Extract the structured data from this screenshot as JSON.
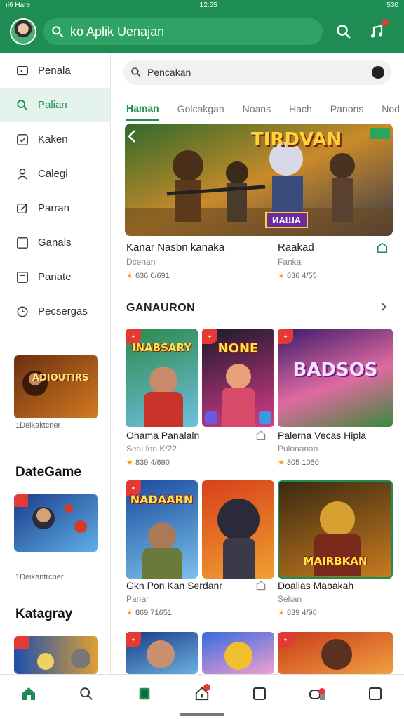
{
  "status": {
    "left": "ıl6 Hare",
    "center": "12:55",
    "right": "530"
  },
  "topbar": {
    "search_text": "ko Aplik Uenajan"
  },
  "sidebar": {
    "items": [
      {
        "label": "Penala",
        "icon": "tv-icon"
      },
      {
        "label": "Palian",
        "icon": "search-icon"
      },
      {
        "label": "Kaken",
        "icon": "checkbox-icon"
      },
      {
        "label": "Calegi",
        "icon": "person-icon"
      },
      {
        "label": "Parran",
        "icon": "edit-icon"
      },
      {
        "label": "Ganals",
        "icon": "square-icon"
      },
      {
        "label": "Panate",
        "icon": "bookmark-icon"
      },
      {
        "label": "Pecsergas",
        "icon": "clock-icon"
      }
    ],
    "card1_caption": "1Deikaktcner",
    "heading1": "DateGame",
    "card2_caption": "1Deikantrcner",
    "heading2": "Katagray"
  },
  "search": {
    "placeholder": "Pencakan"
  },
  "tabs": [
    "Haman",
    "Golcakgan",
    "Noans",
    "Hach",
    "Panons",
    "Nod"
  ],
  "banner": {
    "title_art": "TIRDVAN",
    "sub_art": "ИАША",
    "name_left": "Kanar Nasbn kanaka",
    "sub_left": "Dcenan",
    "rating_left": "636 0/691",
    "name_right": "Raakad",
    "sub_right": "Fanka",
    "rating_right": "836 4/55"
  },
  "section": {
    "title": "GANAURON"
  },
  "grid": [
    {
      "art": "INABSARY",
      "name": "Ohama Panalaln",
      "sub": "Seal fon K/22",
      "rating": "839 4/690"
    },
    {
      "art": "NONE",
      "name": "",
      "sub": "",
      "rating": ""
    },
    {
      "art": "BADSOS",
      "name": "Palerna Vecas Hipla",
      "sub": "Pulonanan",
      "rating": "805 1050"
    },
    {
      "art": "NADAARN",
      "name": "Gkn Pon Kan Serdanr",
      "sub": "Panar",
      "rating": "869 71651"
    },
    {
      "art": "",
      "name": "",
      "sub": "",
      "rating": ""
    },
    {
      "art": "MAIRBKAN",
      "name": "Doalias Mabakah",
      "sub": "Sekan",
      "rating": "839 4/96"
    }
  ],
  "colors": {
    "primary": "#1f8c54",
    "accent_red": "#e53935",
    "star": "#f4a000"
  }
}
